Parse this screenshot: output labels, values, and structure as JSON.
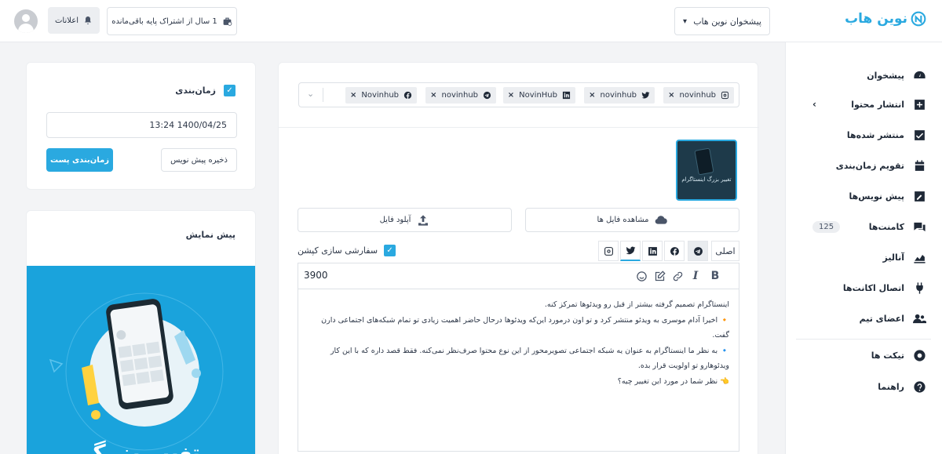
{
  "header": {
    "brand": "نوین هاب",
    "dashboard_select": "پیشخوان نوین هاب",
    "subscription": "1 سال از اشتراک پایه باقی‌مانده",
    "notifications": "اعلانات"
  },
  "sidebar": {
    "items": [
      {
        "label": "پیشخوان",
        "icon": "dashboard-icon"
      },
      {
        "label": "انتشار محتوا",
        "icon": "plus-square-icon"
      },
      {
        "label": "منتشر شده‌ها",
        "icon": "check-square-icon"
      },
      {
        "label": "تقویم زمان‌بندی",
        "icon": "calendar-icon"
      },
      {
        "label": "پیش نویس‌ها",
        "icon": "edit-icon"
      },
      {
        "label": "کامنت‌ها",
        "icon": "comments-icon",
        "badge": "125"
      },
      {
        "label": "آنالیز",
        "icon": "chart-icon"
      },
      {
        "label": "اتصال اکانت‌ها",
        "icon": "plug-icon"
      },
      {
        "label": "اعضای تیم",
        "icon": "users-icon"
      },
      {
        "label": "تیکت ها",
        "icon": "support-icon"
      },
      {
        "label": "راهنما",
        "icon": "help-icon"
      }
    ]
  },
  "accounts": [
    {
      "name": "novinhub",
      "network": "instagram"
    },
    {
      "name": "novinhub",
      "network": "twitter"
    },
    {
      "name": "NovinHub",
      "network": "linkedin"
    },
    {
      "name": "novinhub",
      "network": "telegram"
    },
    {
      "name": "Novinhub",
      "network": "facebook"
    }
  ],
  "media": {
    "thumbnail_text": "تغییر بزرگ اینستاگرام",
    "view_files": "مشاهده فایل ها",
    "upload_file": "آپلود فایل"
  },
  "editor": {
    "tab_main": "اصلی",
    "custom_caption": "سفارشی سازی کپشن",
    "char_count": "3900",
    "lines": [
      "اینستاگرام تصمیم گرفته بیشتر از قبل رو ویدئوها تمرکز کنه.",
      "🔸 اخیرا آدام موسری به ویدئو منتشر کرد و تو اون درمورد این‌که ویدئوها درحال حاضر اهمیت زیادی تو تمام شبکه‌های اجتماعی دارن گفت.",
      "🔹 به نظر ما اینستاگرام به عنوان یه شبکه اجتماعی تصویرمحور از این نوع محتوا صرف‌نظر نمی‌کنه. فقط قصد داره که با این کار ویدئوهارو تو اولویت قرار بده.",
      "👈 نظر شما در مورد این تغییر چیه؟"
    ]
  },
  "schedule": {
    "title": "زمان‌بندی",
    "datetime": "1400/04/25 13:24",
    "save_draft": "ذخیره پیش نویس",
    "schedule_post": "زمان‌بندی پست"
  },
  "preview": {
    "title": "پیش نمایش",
    "image_text": "تغییر بزرگ"
  },
  "colors": {
    "accent": "#2aa9e0",
    "preview_bg": "#1aa3dc"
  }
}
